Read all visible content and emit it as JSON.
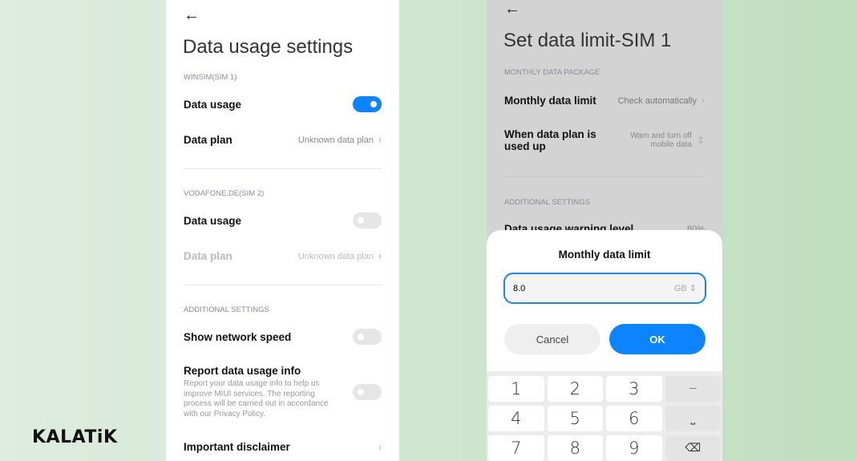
{
  "brand": "KALATiK",
  "left": {
    "title": "Data usage settings",
    "sim1": {
      "header": "WINSIM(SIM 1)",
      "data_usage": "Data usage",
      "data_usage_on": true,
      "data_plan": "Data plan",
      "data_plan_value": "Unknown data plan"
    },
    "sim2": {
      "header": "VODAFONE.DE(SIM 2)",
      "data_usage": "Data usage",
      "data_usage_on": false,
      "data_plan": "Data plan",
      "data_plan_value": "Unknown data plan"
    },
    "additional": {
      "header": "ADDITIONAL SETTINGS",
      "show_speed": "Show network speed",
      "report": "Report data usage info",
      "report_desc": "Report your data usage info to help us improve MIUI services. The reporting process will be carried out in accordance with our Privacy Policy.",
      "disclaimer": "Important disclaimer"
    }
  },
  "right": {
    "title": "Set data limit-SIM 1",
    "package_header": "MONTHLY DATA PACKAGE",
    "monthly_limit": "Monthly data limit",
    "monthly_limit_value": "Check automatically",
    "used_up": "When data plan is used up",
    "used_up_value": "Warn and turn off mobile data",
    "additional_header": "ADDITIONAL SETTINGS",
    "warning_level": "Data usage warning level",
    "warning_level_value": "80%",
    "dialog": {
      "title": "Monthly data limit",
      "value": "8.0",
      "unit": "GB",
      "cancel": "Cancel",
      "ok": "OK"
    },
    "keys": [
      "1",
      "2",
      "3",
      "−",
      "4",
      "5",
      "6",
      "⎵",
      "7",
      "8",
      "9",
      "⌫"
    ]
  },
  "colors": {
    "accent": "#0d84ff"
  }
}
